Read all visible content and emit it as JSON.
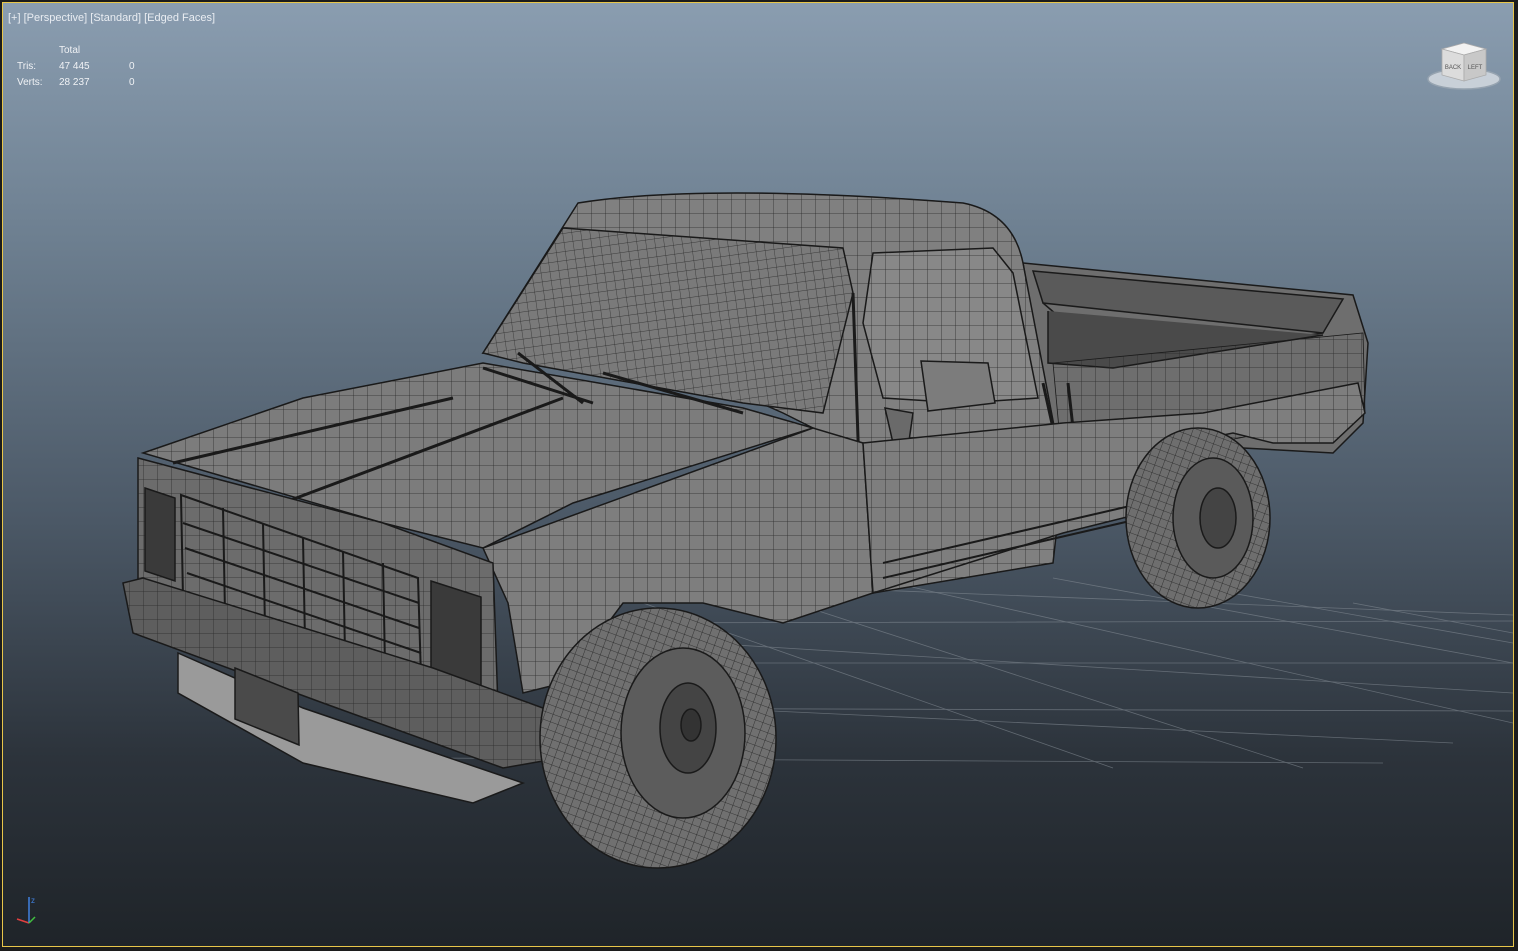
{
  "viewport": {
    "label_parts": [
      "[+]",
      "[Perspective]",
      "[Standard]",
      "[Edged Faces]"
    ],
    "stats": {
      "header": "Total",
      "rows": [
        {
          "label": "Tris:",
          "total": "47 445",
          "selected": "0"
        },
        {
          "label": "Verts:",
          "total": "28 237",
          "selected": "0"
        }
      ]
    },
    "viewcube": {
      "left_face": "BACK",
      "right_face": "LEFT"
    },
    "colors": {
      "border_active": "#e8c64a",
      "bg_top": "#8a9db0",
      "bg_bottom": "#1f2429",
      "grid": "#7a838c",
      "mesh_fill": "#8c8c8c",
      "wire": "#1e1e1e"
    }
  }
}
